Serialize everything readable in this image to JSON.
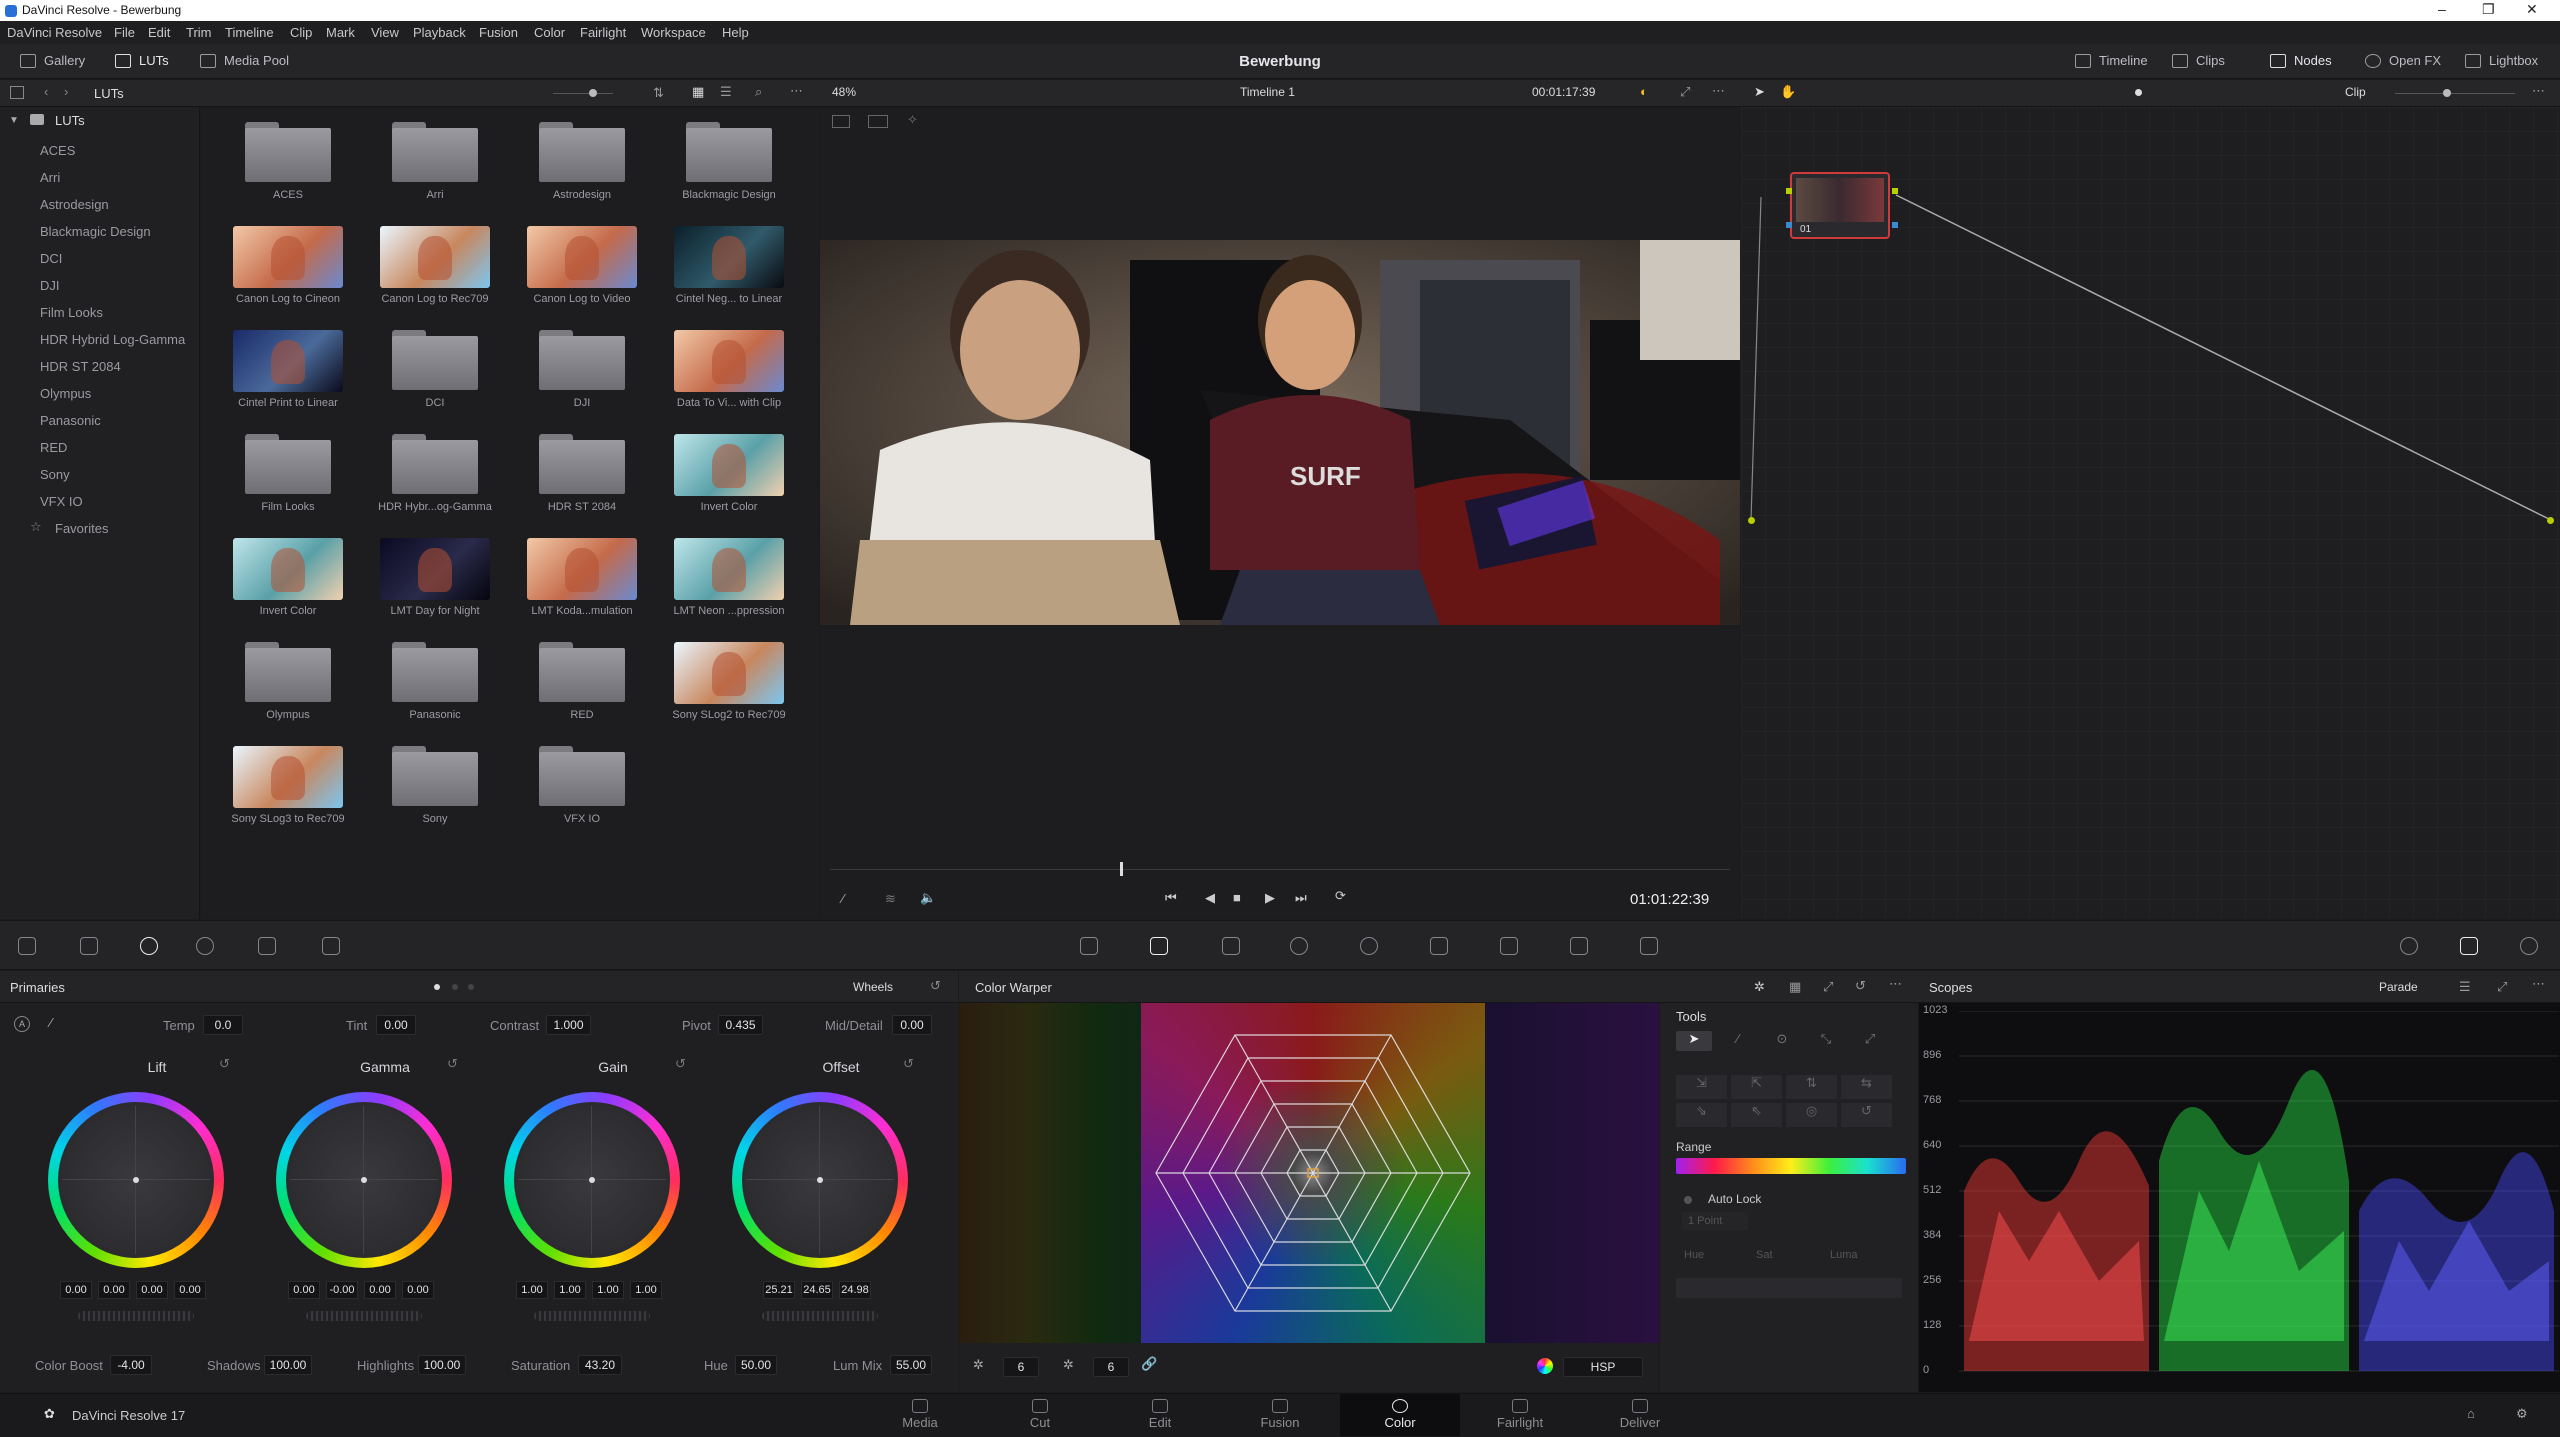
{
  "window": {
    "title": "DaVinci Resolve - Bewerbung",
    "controls": [
      "–",
      "❐",
      "✕"
    ]
  },
  "menu": [
    "DaVinci Resolve",
    "File",
    "Edit",
    "Trim",
    "Timeline",
    "Clip",
    "Mark",
    "View",
    "Playback",
    "Fusion",
    "Color",
    "Fairlight",
    "Workspace",
    "Help"
  ],
  "toolbar": {
    "left": [
      "Gallery",
      "LUTs",
      "Media Pool"
    ],
    "title": "Bewerbung",
    "right": [
      "Timeline",
      "Clips",
      "Nodes",
      "Open FX",
      "Lightbox"
    ]
  },
  "subbar": {
    "panel_title": "LUTs",
    "zoom": "48%",
    "timeline": "Timeline 1",
    "timecode": "00:01:17:39",
    "node_mode": "Clip"
  },
  "lut_tree": {
    "root": "LUTs",
    "items": [
      "ACES",
      "Arri",
      "Astrodesign",
      "Blackmagic Design",
      "DCI",
      "DJI",
      "Film Looks",
      "HDR Hybrid Log-Gamma",
      "HDR ST 2084",
      "Olympus",
      "Panasonic",
      "RED",
      "Sony",
      "VFX IO"
    ],
    "favorites": "Favorites"
  },
  "lut_grid": [
    {
      "label": "ACES",
      "kind": "folder"
    },
    {
      "label": "Arri",
      "kind": "folder"
    },
    {
      "label": "Astrodesign",
      "kind": "folder"
    },
    {
      "label": "Blackmagic Design",
      "kind": "folder"
    },
    {
      "label": "Canon Log to Cineon",
      "kind": "thumb",
      "tone": "warm"
    },
    {
      "label": "Canon Log to Rec709",
      "kind": "thumb",
      "tone": "bright"
    },
    {
      "label": "Canon Log to Video",
      "kind": "thumb",
      "tone": "warm"
    },
    {
      "label": "Cintel Neg... to Linear",
      "kind": "thumb",
      "tone": "dark"
    },
    {
      "label": "Cintel Print to Linear",
      "kind": "thumb",
      "tone": "blue"
    },
    {
      "label": "DCI",
      "kind": "folder"
    },
    {
      "label": "DJI",
      "kind": "folder"
    },
    {
      "label": "Data To Vi... with Clip",
      "kind": "thumb",
      "tone": "warm"
    },
    {
      "label": "Film Looks",
      "kind": "folder"
    },
    {
      "label": "HDR Hybr...og-Gamma",
      "kind": "folder"
    },
    {
      "label": "HDR ST 2084",
      "kind": "folder"
    },
    {
      "label": "Invert Color",
      "kind": "thumb",
      "tone": "invert"
    },
    {
      "label": "Invert Color",
      "kind": "thumb",
      "tone": "invert"
    },
    {
      "label": "LMT Day for Night",
      "kind": "thumb",
      "tone": "night"
    },
    {
      "label": "LMT Koda...mulation",
      "kind": "thumb",
      "tone": "warm"
    },
    {
      "label": "LMT Neon ...ppression",
      "kind": "thumb",
      "tone": "invert"
    },
    {
      "label": "Olympus",
      "kind": "folder"
    },
    {
      "label": "Panasonic",
      "kind": "folder"
    },
    {
      "label": "RED",
      "kind": "folder"
    },
    {
      "label": "Sony SLog2 to Rec709",
      "kind": "thumb",
      "tone": "bright"
    },
    {
      "label": "Sony SLog3 to Rec709",
      "kind": "thumb",
      "tone": "bright"
    },
    {
      "label": "Sony",
      "kind": "folder"
    },
    {
      "label": "VFX IO",
      "kind": "folder"
    }
  ],
  "viewer": {
    "playhead_timecode": "01:01:22:39"
  },
  "nodes": {
    "node_label": "01"
  },
  "primaries": {
    "title": "Primaries",
    "mode": "Wheels",
    "temp": {
      "label": "Temp",
      "value": "0.0"
    },
    "tint": {
      "label": "Tint",
      "value": "0.00"
    },
    "contrast": {
      "label": "Contrast",
      "value": "1.000"
    },
    "pivot": {
      "label": "Pivot",
      "value": "0.435"
    },
    "mid_detail": {
      "label": "Mid/Detail",
      "value": "0.00"
    },
    "wheels": [
      {
        "name": "Lift",
        "values": [
          "0.00",
          "0.00",
          "0.00",
          "0.00"
        ]
      },
      {
        "name": "Gamma",
        "values": [
          "0.00",
          "-0.00",
          "0.00",
          "0.00"
        ]
      },
      {
        "name": "Gain",
        "values": [
          "1.00",
          "1.00",
          "1.00",
          "1.00"
        ]
      },
      {
        "name": "Offset",
        "values": [
          "25.21",
          "24.65",
          "24.98"
        ]
      }
    ],
    "bottom": [
      {
        "label": "Color Boost",
        "value": "-4.00"
      },
      {
        "label": "Shadows",
        "value": "100.00"
      },
      {
        "label": "Highlights",
        "value": "100.00"
      },
      {
        "label": "Saturation",
        "value": "43.20"
      },
      {
        "label": "Hue",
        "value": "50.00"
      },
      {
        "label": "Lum Mix",
        "value": "55.00"
      }
    ]
  },
  "warper": {
    "title": "Color Warper",
    "grid_a": "6",
    "grid_b": "6",
    "colorspace": "HSP"
  },
  "tools": {
    "title": "Tools",
    "range": "Range",
    "auto_lock": "Auto Lock",
    "point": "1 Point",
    "hue": "Hue",
    "sat": "Sat",
    "luma": "Luma"
  },
  "scopes": {
    "title": "Scopes",
    "mode": "Parade",
    "ticks": [
      "1023",
      "896",
      "768",
      "640",
      "512",
      "384",
      "256",
      "128",
      "0"
    ]
  },
  "pages": [
    "Media",
    "Cut",
    "Edit",
    "Fusion",
    "Color",
    "Fairlight",
    "Deliver"
  ],
  "active_page": "Color",
  "app_name": "DaVinci Resolve 17"
}
